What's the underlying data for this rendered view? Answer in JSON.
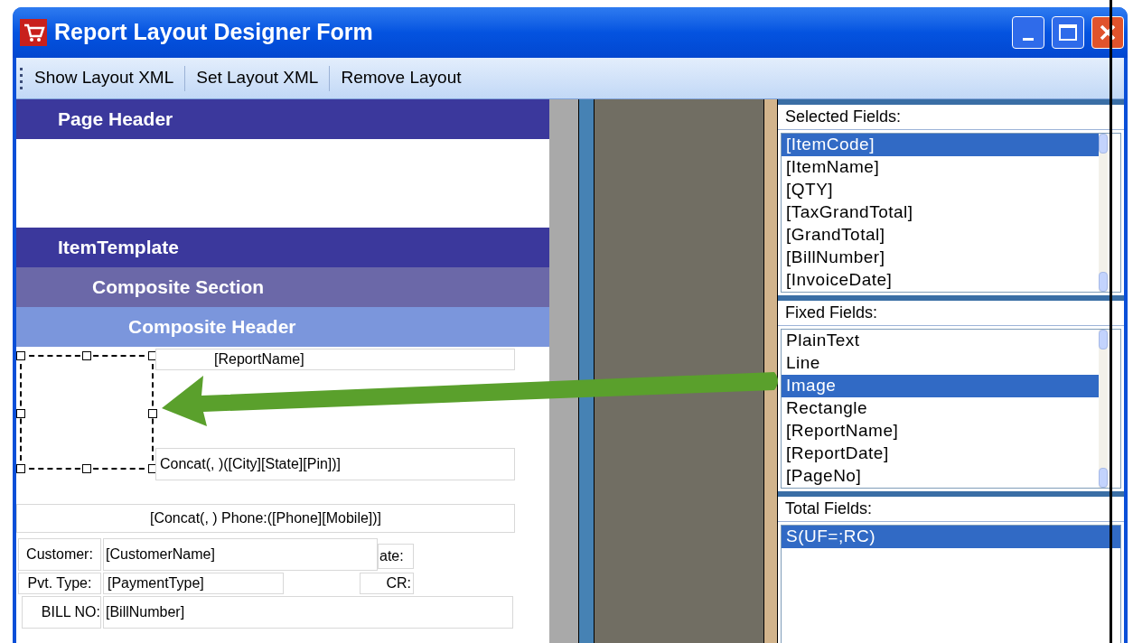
{
  "window": {
    "title": "Report Layout Designer Form"
  },
  "toolbar": [
    "Show Layout XML",
    "Set Layout XML",
    "Remove Layout"
  ],
  "bands": [
    {
      "label": "Page Header"
    },
    {
      "label": "ItemTemplate",
      "children": [
        {
          "label": "Composite Section",
          "children": [
            {
              "label": "Composite Header"
            }
          ]
        }
      ]
    }
  ],
  "canvas_controls": [
    {
      "kind": "image",
      "selected": true
    },
    {
      "kind": "label",
      "text": "[ReportName]"
    },
    {
      "kind": "label",
      "text": "Concat(, )([City][State][Pin])]"
    },
    {
      "kind": "label",
      "text": "[Concat(, ) Phone:([Phone][Mobile])]"
    },
    {
      "kind": "label",
      "text": "Customer:"
    },
    {
      "kind": "field",
      "text": "[CustomerName]"
    },
    {
      "kind": "label",
      "text": "ate:"
    },
    {
      "kind": "label",
      "text": "Pvt. Type:"
    },
    {
      "kind": "label",
      "text": "[PaymentType]"
    },
    {
      "kind": "label",
      "text": "CR:"
    },
    {
      "kind": "label",
      "text": "BILL NO:"
    },
    {
      "kind": "field",
      "text": "[BillNumber]"
    }
  ],
  "selected_fields": {
    "label": "Selected Fields:",
    "items": [
      {
        "text": "[ItemCode]",
        "selected": true
      },
      {
        "text": "[ItemName]",
        "selected": false
      },
      {
        "text": "[QTY]",
        "selected": false
      },
      {
        "text": "[TaxGrandTotal]",
        "selected": false
      },
      {
        "text": "[GrandTotal]",
        "selected": false
      },
      {
        "text": "[BillNumber]",
        "selected": false
      },
      {
        "text": "[InvoiceDate]",
        "selected": false
      }
    ]
  },
  "fixed_fields": {
    "label": "Fixed Fields:",
    "items": [
      {
        "text": "PlainText",
        "selected": false
      },
      {
        "text": "Line",
        "selected": false
      },
      {
        "text": "Image",
        "selected": true
      },
      {
        "text": "Rectangle",
        "selected": false
      },
      {
        "text": "[ReportName]",
        "selected": false
      },
      {
        "text": "[ReportDate]",
        "selected": false
      },
      {
        "text": "[PageNo]",
        "selected": false
      }
    ]
  },
  "total_fields": {
    "label": "Total Fields:",
    "items": [
      {
        "text": "S(UF=;RC)",
        "selected": true
      }
    ]
  }
}
